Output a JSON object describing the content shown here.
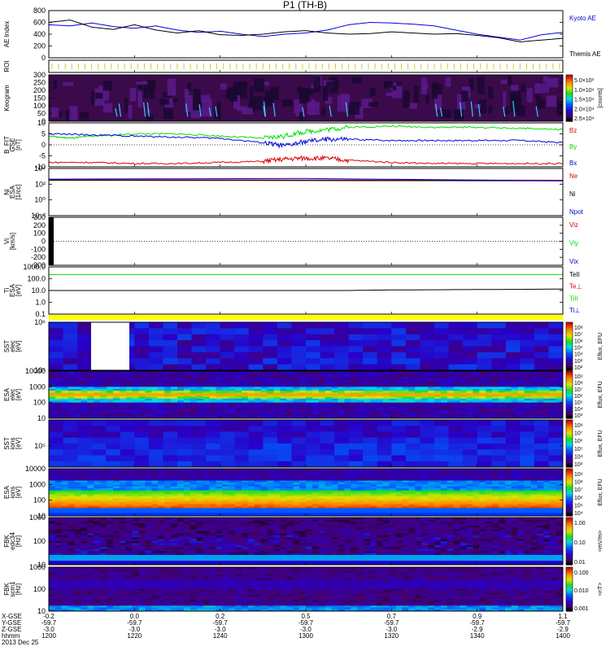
{
  "title": "P1 (TH-B)",
  "bottom": {
    "rows": [
      "X-GSE",
      "Y-GSE",
      "Z-GSE",
      "hhmm"
    ],
    "date": "2013 Dec 25",
    "cols": [
      [
        "-0.2",
        "-59.7",
        "-3.0",
        "1200"
      ],
      [
        "0.0",
        "-59.7",
        "-3.0",
        "1220"
      ],
      [
        "0.2",
        "-59.7",
        "-3.0",
        "1240"
      ],
      [
        "0.5",
        "-59.7",
        "-3.0",
        "1300"
      ],
      [
        "0.7",
        "-59.7",
        "-3.0",
        "1320"
      ],
      [
        "0.9",
        "-59.7",
        "-2.9",
        "1340"
      ],
      [
        "1.1",
        "-59.7",
        "-2.9",
        "1400"
      ]
    ]
  },
  "colors": {
    "blue": "#0000dd",
    "red": "#dd0000",
    "green": "#00dd00",
    "black": "#000000",
    "roi": "#cccc33",
    "bar": "#ffff00"
  },
  "chart_data": {
    "type": "line",
    "title": "P1 (TH-B)",
    "x_range": [
      "12:00",
      "14:00"
    ],
    "panels": [
      {
        "id": "ae",
        "ylabel": [
          "AE Index"
        ],
        "ylim": [
          0,
          800
        ],
        "yticks": [
          "0",
          "200",
          "400",
          "600",
          "800"
        ],
        "legend": [
          {
            "text": "Kyoto AE",
            "color": "blue"
          },
          {
            "text": "Themis AE",
            "color": "black"
          }
        ],
        "series": [
          {
            "name": "Kyoto AE",
            "color": "blue",
            "x": [
              0,
              5,
              10,
              15,
              20,
              25,
              30,
              35,
              40,
              45,
              50,
              55,
              60,
              65,
              70,
              75,
              80,
              85,
              90,
              95,
              100,
              105,
              110,
              115,
              120
            ],
            "y": [
              560,
              540,
              590,
              530,
              500,
              540,
              470,
              430,
              450,
              400,
              360,
              400,
              420,
              470,
              560,
              600,
              590,
              570,
              540,
              470,
              400,
              350,
              300,
              390,
              430
            ]
          },
          {
            "name": "Themis AE",
            "color": "black",
            "x": [
              0,
              5,
              10,
              15,
              20,
              25,
              30,
              35,
              40,
              45,
              50,
              55,
              60,
              65,
              70,
              75,
              80,
              85,
              90,
              95,
              100,
              105,
              110,
              115,
              120
            ],
            "y": [
              600,
              640,
              520,
              480,
              560,
              470,
              420,
              460,
              390,
              380,
              400,
              440,
              460,
              420,
              400,
              410,
              440,
              420,
              400,
              410,
              380,
              340,
              270,
              300,
              330
            ]
          }
        ]
      },
      {
        "id": "roi",
        "ylabel": [
          "ROI"
        ],
        "ylim": [
          0,
          1
        ],
        "yticks": []
      },
      {
        "id": "keogram",
        "ylabel": [
          "Keogram"
        ],
        "ylim": [
          0,
          300
        ],
        "yticks": [
          "0",
          "50",
          "100",
          "150",
          "200",
          "250",
          "300"
        ],
        "colorbar": {
          "labels": [
            "5.0×10³",
            "1.0×10⁴",
            "1.5×10⁴",
            "2.0×10⁴",
            "2.5×10⁴"
          ],
          "title": "[counts]"
        }
      },
      {
        "id": "bfit",
        "ylabel": [
          "B_FIT",
          "GSE",
          "[nT]"
        ],
        "ylim": [
          -10,
          10
        ],
        "yticks": [
          "-10",
          "-5",
          "0",
          "5",
          "10"
        ],
        "legend": [
          {
            "text": "Bz",
            "color": "red"
          },
          {
            "text": "By",
            "color": "green"
          },
          {
            "text": "Bx",
            "color": "blue"
          }
        ],
        "series": [
          {
            "name": "Bz",
            "color": "red",
            "x": [
              0,
              10,
              20,
              30,
              40,
              50,
              55,
              60,
              65,
              70,
              80,
              90,
              100,
              110,
              120
            ],
            "y": [
              -8,
              -8,
              -8.5,
              -8.5,
              -8,
              -7.5,
              -6.5,
              -6,
              -6.2,
              -7,
              -8,
              -8.5,
              -8.5,
              -8.5,
              -8.5
            ]
          },
          {
            "name": "By",
            "color": "green",
            "x": [
              0,
              5,
              10,
              20,
              30,
              40,
              50,
              55,
              60,
              65,
              70,
              80,
              90,
              100,
              110,
              120
            ],
            "y": [
              4,
              3,
              4,
              5,
              5,
              4,
              3,
              4,
              6,
              7,
              8,
              8.5,
              8,
              8,
              7.5,
              7
            ]
          },
          {
            "name": "Bx",
            "color": "blue",
            "x": [
              0,
              10,
              20,
              30,
              40,
              50,
              55,
              60,
              65,
              70,
              80,
              90,
              100,
              110,
              120
            ],
            "y": [
              5,
              4.5,
              4,
              3.5,
              3,
              1,
              -0.5,
              1.5,
              2.5,
              2.5,
              2,
              2,
              2,
              2,
              1
            ]
          }
        ]
      },
      {
        "id": "ni",
        "ylabel": [
          "Ni",
          "ESA",
          "[1/cc]"
        ],
        "ylim": [
          -4,
          4
        ],
        "yticks": [
          "10⁻²",
          "10⁰",
          "10²",
          "10⁴"
        ],
        "legend": [
          {
            "text": "Ne",
            "color": "red"
          },
          {
            "text": "Ni",
            "color": "black"
          },
          {
            "text": "Npot",
            "color": "blue"
          }
        ],
        "series": [
          {
            "name": "Ne",
            "color": "red",
            "x": [
              0,
              120
            ],
            "y": [
              2.1,
              2.0
            ]
          },
          {
            "name": "Ni",
            "color": "black",
            "x": [
              0,
              120
            ],
            "y": [
              2.0,
              1.9
            ]
          },
          {
            "name": "Npot",
            "color": "blue",
            "x": [
              0,
              60,
              120
            ],
            "y": [
              2.2,
              2.3,
              1.9
            ]
          }
        ]
      },
      {
        "id": "vi",
        "ylabel": [
          "Vi",
          "[km/s]"
        ],
        "ylim": [
          -300,
          300
        ],
        "yticks": [
          "-300",
          "-200",
          "-100",
          "0",
          "100",
          "200",
          "300"
        ],
        "legend": [
          {
            "text": "Viz",
            "color": "red"
          },
          {
            "text": "Viy",
            "color": "green"
          },
          {
            "text": "Vix",
            "color": "blue"
          }
        ]
      },
      {
        "id": "ti",
        "ylabel": [
          "Ti",
          "ESA",
          "[eV]"
        ],
        "ylim": [
          -1,
          3
        ],
        "yticks": [
          "0.1",
          "1.0",
          "10.0",
          "100.0",
          "1000.0"
        ],
        "legend": [
          {
            "text": "TeII",
            "color": "black"
          },
          {
            "text": "Te⊥",
            "color": "red"
          },
          {
            "text": "TiII",
            "color": "green"
          },
          {
            "text": "Ti⊥",
            "color": "blue"
          }
        ],
        "series": [
          {
            "name": "TiII",
            "color": "green",
            "x": [
              0,
              120
            ],
            "y": [
              2.35,
              2.35
            ]
          },
          {
            "name": "TeII",
            "color": "black",
            "x": [
              0,
              70,
              80,
              100,
              120
            ],
            "y": [
              1.0,
              1.0,
              1.05,
              1.08,
              1.12
            ]
          }
        ]
      },
      {
        "id": "bar"
      },
      {
        "id": "sst_e",
        "ylabel": [
          "SST",
          "elec",
          "[eV]"
        ],
        "ylim": [
          4.7,
          6.3
        ],
        "yticks": [
          "10⁵",
          "10⁶"
        ],
        "colorbar": {
          "labels": [
            "10⁸",
            "10⁷",
            "10⁶",
            "10⁵",
            "10⁴",
            "10³",
            "10²"
          ],
          "title": "Eflux, EFU"
        }
      },
      {
        "id": "esa_e",
        "ylabel": [
          "ESA",
          "elec",
          "[eV]"
        ],
        "ylim": [
          0.5,
          4.3
        ],
        "yticks": [
          "10",
          "100",
          "1000",
          "10000"
        ],
        "colorbar": {
          "labels": [
            "10⁹",
            "10⁸",
            "10⁷",
            "10⁶",
            "10⁵",
            "10⁴",
            "10³"
          ],
          "title": "Eflux, EFU"
        }
      },
      {
        "id": "sst_i",
        "ylabel": [
          "SST",
          "ions",
          "[eV]"
        ],
        "ylim": [
          4.2,
          6.3
        ],
        "yticks": [
          "10⁵"
        ],
        "colorbar": {
          "labels": [
            "10⁸",
            "10⁷",
            "10⁶",
            "10⁵",
            "10⁴",
            "10³"
          ],
          "title": "Eflux, EFU"
        }
      },
      {
        "id": "esa_i",
        "ylabel": [
          "ESA",
          "ions",
          "[eV]"
        ],
        "ylim": [
          0.7,
          4.4
        ],
        "yticks": [
          "10",
          "100",
          "1000",
          "10000"
        ],
        "colorbar": {
          "labels": [
            "10⁹",
            "10⁸",
            "10⁷",
            "10⁶",
            "10⁵",
            "10⁴"
          ],
          "title": "Eflux, EFU"
        }
      },
      {
        "id": "fbk_e",
        "ylabel": [
          "FBK",
          "edc34",
          "[Hz]"
        ],
        "ylim": [
          0.5,
          3.1
        ],
        "yticks": [
          "10",
          "100",
          "1000"
        ],
        "colorbar": {
          "labels": [
            "1.00",
            "0.10",
            "0.01"
          ],
          "title": "<mV/m>"
        }
      },
      {
        "id": "fbk_s",
        "ylabel": [
          "FBK",
          "scm1",
          "[Hz]"
        ],
        "ylim": [
          0.5,
          3.1
        ],
        "yticks": [
          "10",
          "100",
          "1000"
        ],
        "colorbar": {
          "labels": [
            "0.100",
            "0.010",
            "0.001"
          ],
          "title": "<nT>"
        }
      }
    ]
  }
}
